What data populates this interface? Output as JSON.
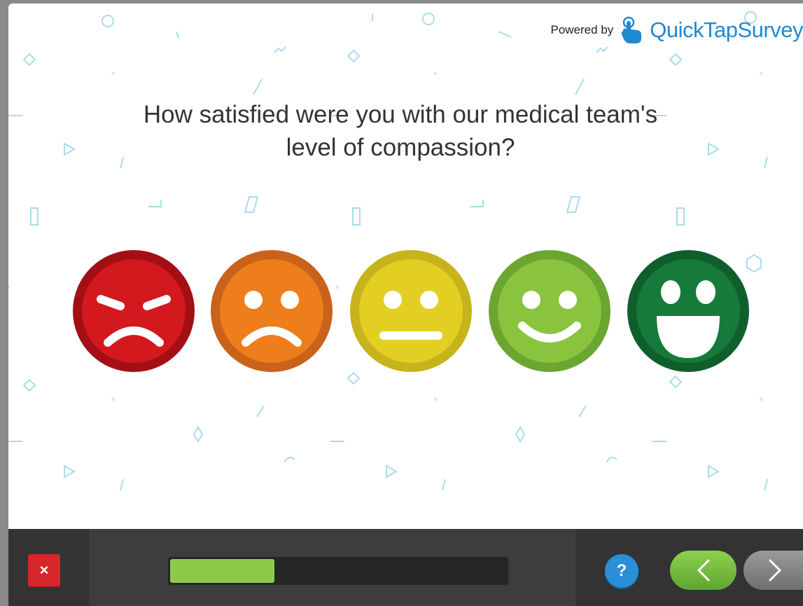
{
  "branding": {
    "powered_by": "Powered by",
    "brand_name": "QuickTapSurvey",
    "brand_color": "#1f8ad0"
  },
  "question": {
    "line1": "How satisfied were you with our medical team's",
    "line2": "level of compassion?"
  },
  "rating_options": [
    {
      "name": "very-dissatisfied",
      "color": "#d3181e",
      "icon": "angry-face-icon"
    },
    {
      "name": "dissatisfied",
      "color": "#ee7d1c",
      "icon": "frowning-face-icon"
    },
    {
      "name": "neutral",
      "color": "#e3cf24",
      "icon": "neutral-face-icon"
    },
    {
      "name": "satisfied",
      "color": "#8ac43f",
      "icon": "smiling-face-icon"
    },
    {
      "name": "very-satisfied",
      "color": "#167a3a",
      "icon": "grinning-face-icon"
    }
  ],
  "footer": {
    "close_label": "×",
    "help_label": "?",
    "back_icon": "chevron-left-icon",
    "next_icon": "chevron-right-icon",
    "progress_fraction": 0.31,
    "progress_color": "#8fc94a"
  }
}
